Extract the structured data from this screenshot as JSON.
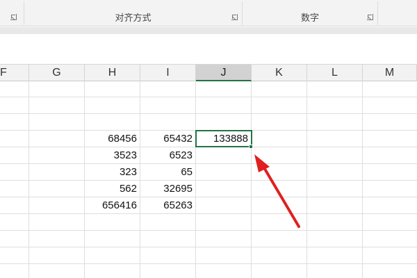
{
  "ribbon": {
    "groups": [
      {
        "label": ""
      },
      {
        "label": "对齐方式"
      },
      {
        "label": "数字"
      },
      {
        "label": ""
      }
    ]
  },
  "columns": [
    "F",
    "G",
    "H",
    "I",
    "J",
    "K",
    "L",
    "M"
  ],
  "selected_column": "J",
  "cells": {
    "H": [
      "68456",
      "3523",
      "323",
      "562",
      "656416"
    ],
    "I": [
      "65432",
      "6523",
      "65",
      "32695",
      "65263"
    ],
    "J": [
      "133888"
    ]
  },
  "active_cell_value": "133888",
  "colors": {
    "accent": "#217346",
    "annotation_arrow": "#e02020"
  },
  "icons": [
    "dialog-launcher-icon",
    "annotation-arrow"
  ]
}
